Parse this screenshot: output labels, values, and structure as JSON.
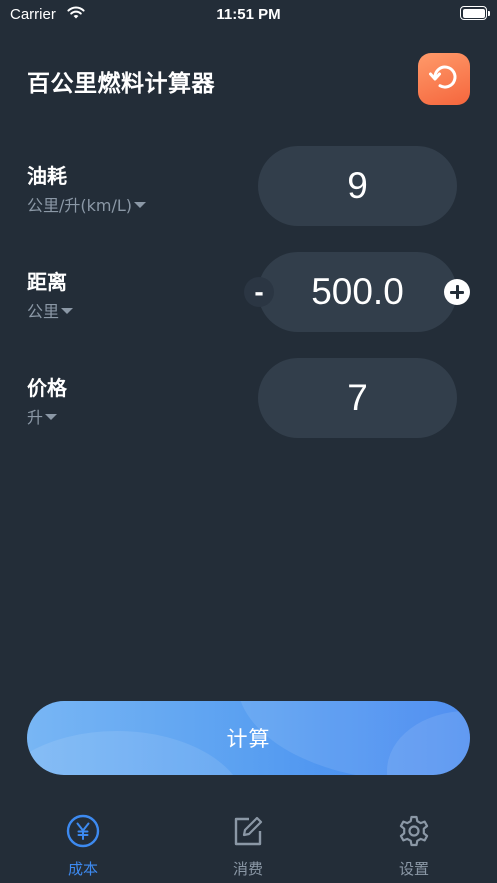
{
  "status_bar": {
    "carrier": "Carrier",
    "time": "11:51 PM",
    "battery_level": 1.0
  },
  "header": {
    "title": "百公里燃料计算器",
    "reset_icon": "reset-rotate-icon",
    "reset_color": "#f87548"
  },
  "fields": [
    {
      "label": "油耗",
      "unit": "公里/升(km/L)",
      "value": "9"
    },
    {
      "label": "距离",
      "unit": "公里",
      "value": "500.0",
      "decrement": "-"
    },
    {
      "label": "价格",
      "unit": "升",
      "value": "7"
    }
  ],
  "calculate_button": {
    "label": "计算"
  },
  "tabs": [
    {
      "label": "成本",
      "icon": "yen-circle-icon",
      "active": true
    },
    {
      "label": "消费",
      "icon": "edit-square-icon",
      "active": false
    },
    {
      "label": "设置",
      "icon": "gear-icon",
      "active": false
    }
  ],
  "colors": {
    "background": "#232d38",
    "pill": "#323e4b",
    "accent": "#3d8af0",
    "muted": "#8b98a6",
    "reset": "#f87548"
  }
}
